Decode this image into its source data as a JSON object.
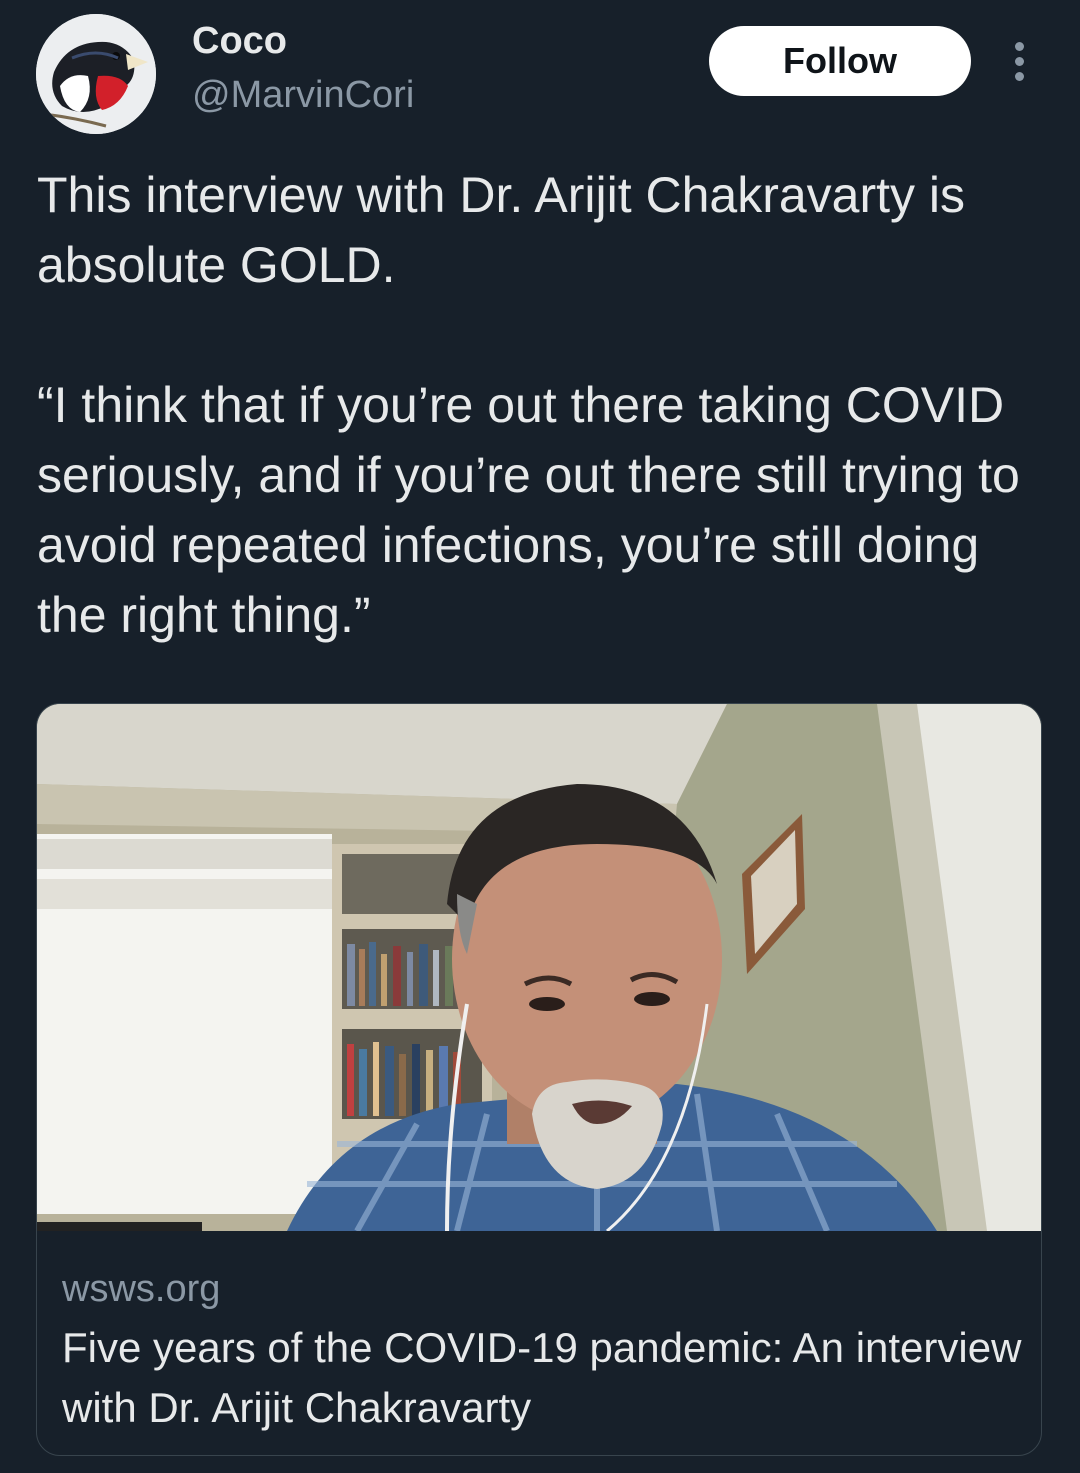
{
  "author": {
    "display_name": "Coco",
    "handle": "@MarvinCori"
  },
  "actions": {
    "follow_label": "Follow"
  },
  "tweet": {
    "text": "This interview with Dr. Arijit Chakravarty is absolute GOLD.\n\n“I think that if you’re out there taking COVID seriously, and if you’re out there still trying to avoid repeated infections, you’re still doing the right thing.”"
  },
  "card": {
    "domain": "wsws.org",
    "title": "Five years of the COVID-19 pandemic: An interview with Dr. Arijit Chakravarty"
  },
  "colors": {
    "background": "#17202a",
    "text_primary": "#e7e9ea",
    "text_secondary": "#8b98a5",
    "border": "#38444d",
    "follow_bg": "#ffffff"
  },
  "icons": {
    "more": "more-vertical-icon"
  }
}
